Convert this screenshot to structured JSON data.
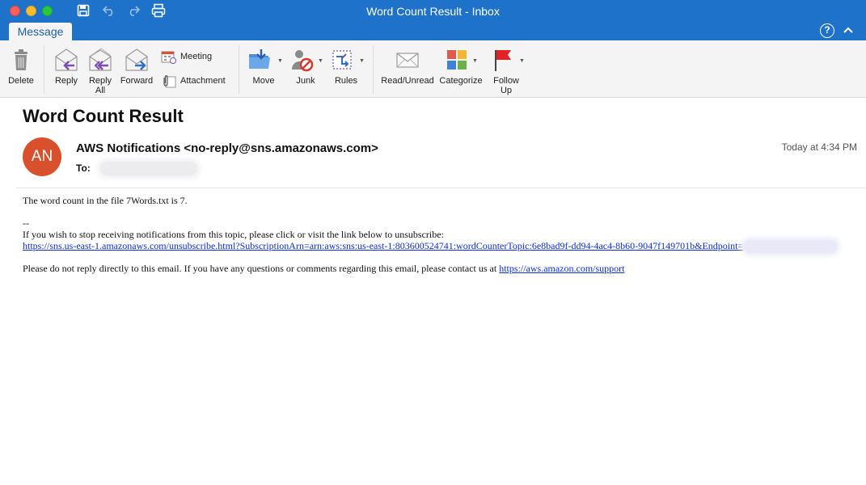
{
  "window": {
    "title": "Word Count Result - Inbox"
  },
  "tabs": {
    "message": "Message"
  },
  "help_glyph": "?",
  "ribbon": {
    "delete": "Delete",
    "reply": "Reply",
    "reply_all_line1": "Reply",
    "reply_all_line2": "All",
    "forward": "Forward",
    "meeting": "Meeting",
    "attachment": "Attachment",
    "move": "Move",
    "junk": "Junk",
    "rules": "Rules",
    "read_unread": "Read/Unread",
    "categorize": "Categorize",
    "follow_up_line1": "Follow",
    "follow_up_line2": "Up"
  },
  "message": {
    "subject": "Word Count Result",
    "avatar_initials": "AN",
    "avatar_color": "#d9512c",
    "sender": "AWS Notifications <no-reply@sns.amazonaws.com>",
    "to_label": "To:",
    "date": "Today at 4:34 PM",
    "body_line1": "The word count in the file 7Words.txt is 7.",
    "signature_sep": "--",
    "unsubscribe_text": "If you wish to stop receiving notifications from this topic, please click or visit the link below to unsubscribe:",
    "unsubscribe_link": "https://sns.us-east-1.amazonaws.com/unsubscribe.html?SubscriptionArn=arn:aws:sns:us-east-1:803600524741:wordCounterTopic:6e8bad9f-dd94-4ac4-8b60-9047f149701b&Endpoint=",
    "footer_text": "Please do not reply directly to this email. If you have any questions or comments regarding this email, please contact us at ",
    "support_link": "https://aws.amazon.com/support"
  },
  "colors": {
    "titlebar": "#1f72c9",
    "link": "#0c2ed6"
  }
}
